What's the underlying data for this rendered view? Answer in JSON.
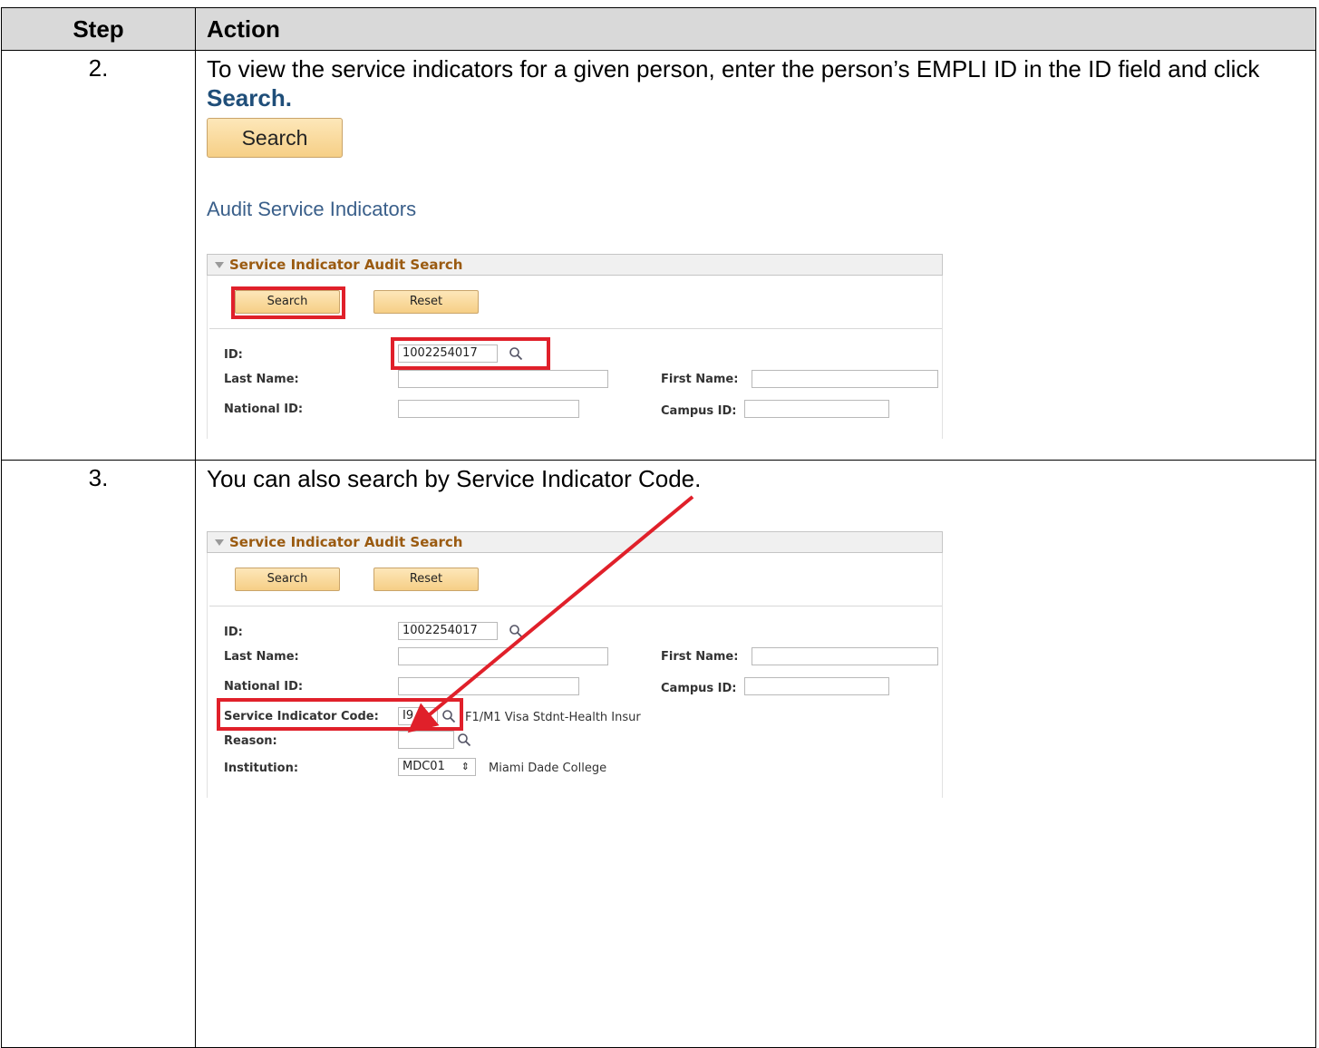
{
  "header": {
    "step": "Step",
    "action": "Action"
  },
  "rows": [
    {
      "step": "2.",
      "text_before": "To view the service indicators for a given person, enter the person’s EMPLI ID in the ID field and click ",
      "text_keyword": "Search.",
      "button_label": "Search",
      "page_title": "Audit Service Indicators",
      "panel": {
        "title": "Service Indicator Audit Search",
        "search_label": "Search",
        "reset_label": "Reset",
        "id_label": "ID:",
        "id_value": "1002254017",
        "last_name_label": "Last Name:",
        "first_name_label": "First Name:",
        "national_id_label": "National ID:",
        "campus_id_label": "Campus ID:"
      }
    },
    {
      "step": "3.",
      "text": "You can also search by Service Indicator Code.",
      "panel": {
        "title": "Service Indicator Audit Search",
        "search_label": "Search",
        "reset_label": "Reset",
        "id_label": "ID:",
        "id_value": "1002254017",
        "last_name_label": "Last Name:",
        "first_name_label": "First Name:",
        "national_id_label": "National ID:",
        "campus_id_label": "Campus ID:",
        "sic_label": "Service Indicator Code:",
        "sic_value": "I9",
        "sic_desc": "F1/M1 Visa Stdnt-Health Insur",
        "reason_label": "Reason:",
        "institution_label": "Institution:",
        "institution_value": "MDC01",
        "institution_desc": "Miami Dade College"
      }
    }
  ],
  "colors": {
    "highlight": "#e0202a",
    "keyword": "#1f4e79",
    "panel_title": "#9a5a10"
  }
}
